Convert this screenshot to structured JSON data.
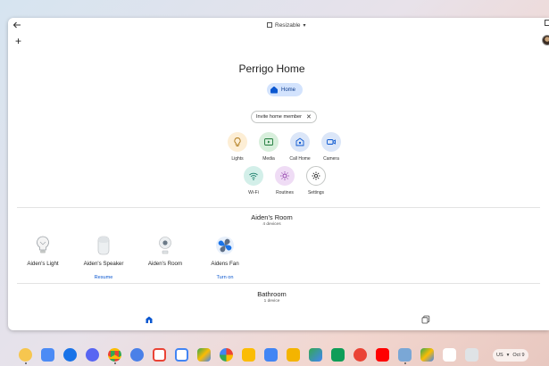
{
  "window": {
    "resize_label": "Resizable"
  },
  "home": {
    "title": "Perrigo Home",
    "chip_label": "Home",
    "invite_label": "Invite home member"
  },
  "actions": [
    {
      "label": "Lights",
      "icon": "lightbulb-icon",
      "bg": "#fdeed5"
    },
    {
      "label": "Media",
      "icon": "play-icon",
      "bg": "#d8efdc"
    },
    {
      "label": "Call Home",
      "icon": "call-home-icon",
      "bg": "#dbe6f8"
    },
    {
      "label": "Camera",
      "icon": "camera-icon",
      "bg": "#dbe6f8"
    },
    {
      "label": "Wi-Fi",
      "icon": "wifi-icon",
      "bg": "#d3efe9"
    },
    {
      "label": "Routines",
      "icon": "sun-icon",
      "bg": "#efdcf5"
    },
    {
      "label": "Settings",
      "icon": "gear-icon",
      "bg": "#ffffff"
    }
  ],
  "rooms": [
    {
      "name": "Aiden's Room",
      "count": "4 devices",
      "devices": [
        {
          "name": "Aiden's Light",
          "icon": "bulb-device-icon",
          "action": ""
        },
        {
          "name": "Aiden's Speaker",
          "icon": "speaker-device-icon",
          "action": "Resume"
        },
        {
          "name": "Aiden's Room",
          "icon": "camera-device-icon",
          "action": ""
        },
        {
          "name": "Aidens Fan",
          "icon": "fan-device-icon",
          "action": "Turn on"
        }
      ]
    },
    {
      "name": "Bathroom",
      "count": "1 device",
      "devices": []
    }
  ],
  "nav": {
    "items": [
      "home-icon",
      "devices-icon"
    ]
  },
  "shelf": {
    "apps": [
      "launcher",
      "files",
      "messages",
      "discord",
      "chrome",
      "contacts",
      "gmail",
      "calendar",
      "drive",
      "photos",
      "keep",
      "docs",
      "slides",
      "maps",
      "sheets",
      "podcast",
      "youtube",
      "finder",
      "drive-2",
      "pen"
    ],
    "status": {
      "locale": "US",
      "date": "Oct 9"
    }
  },
  "colors": {
    "accent": "#0b57d0",
    "chip_bg": "#d3e3fd"
  }
}
